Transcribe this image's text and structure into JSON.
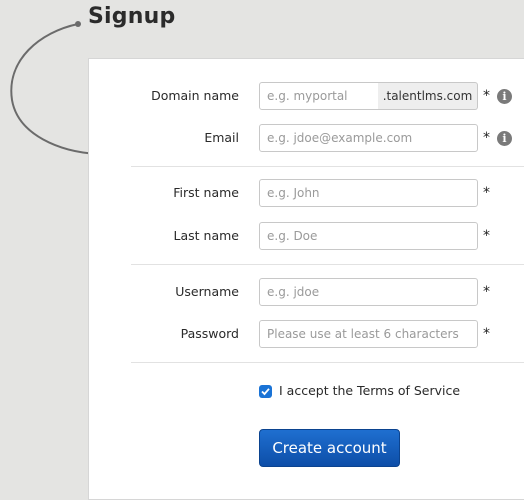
{
  "page": {
    "title": "Signup"
  },
  "form": {
    "domain": {
      "label": "Domain name",
      "placeholder": "e.g. myportal",
      "suffix": ".talentlms.com",
      "required_mark": "*",
      "info_icon": "info-icon"
    },
    "email": {
      "label": "Email",
      "placeholder": "e.g. jdoe@example.com",
      "required_mark": "*",
      "info_icon": "info-icon"
    },
    "first_name": {
      "label": "First name",
      "placeholder": "e.g. John",
      "required_mark": "*"
    },
    "last_name": {
      "label": "Last name",
      "placeholder": "e.g. Doe",
      "required_mark": "*"
    },
    "username": {
      "label": "Username",
      "placeholder": "e.g. jdoe",
      "required_mark": "*"
    },
    "password": {
      "label": "Password",
      "placeholder": "Please use at least 6 characters",
      "required_mark": "*"
    },
    "terms": {
      "label": "I accept the Terms of Service",
      "checked": true
    },
    "submit_label": "Create account"
  },
  "colors": {
    "accent": "#1a73d6",
    "button": "#0d4ea8",
    "background": "#e4e4e2"
  }
}
